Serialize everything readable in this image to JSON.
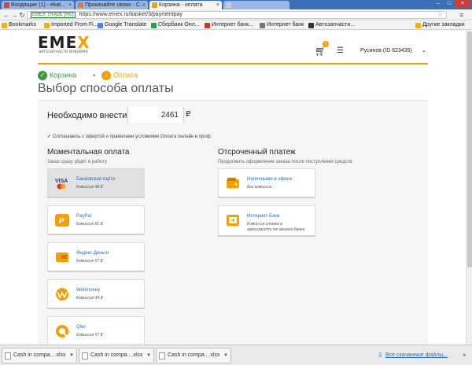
{
  "browser": {
    "tabs": [
      {
        "label": "Входящие (1) - ekat...",
        "active": false,
        "icon_color": "#d44638"
      },
      {
        "label": "Прокачайте своих - С...",
        "active": false,
        "icon_color": "#e07b39"
      },
      {
        "label": "Корзина - оплата",
        "active": true,
        "icon_color": "#f5a000"
      },
      {
        "label": "",
        "active": false,
        "icon_color": "#cccccc"
      }
    ],
    "url_secure": "EMEX TRADE [RU]",
    "url": "https://www.emex.ru/basket/3/paymentpay",
    "bookmarks": [
      {
        "label": "Bookmarks",
        "icon_color": "#f0b400"
      },
      {
        "label": "Imported From Fi...",
        "icon_color": "#f0b400"
      },
      {
        "label": "Google Translate",
        "icon_color": "#4285f4"
      },
      {
        "label": "Сбербанк Онл...",
        "icon_color": "#1ea345"
      },
      {
        "label": "Интернет банк...",
        "icon_color": "#c0392b"
      },
      {
        "label": "Интернет банк",
        "icon_color": "#777777"
      },
      {
        "label": "Автозапчасти...",
        "icon_color": "#333333"
      },
      {
        "label": "Другие закладки",
        "icon_color": "#f0b400"
      }
    ]
  },
  "site": {
    "logo_e1": "E",
    "logo_m": "M",
    "logo_e2": "E",
    "logo_x": "X",
    "logo_sub": "автозапчасти вовремя",
    "cart_count": "1",
    "user": "Русинов (ID 623435)",
    "accent_color": "#f5a000"
  },
  "steps": {
    "cart": "Корзина",
    "payment": "Оплата"
  },
  "page_title": "Выбор способа оплаты",
  "amount": {
    "label": "Необходимо внести",
    "value": "2461",
    "currency": "₽"
  },
  "agreement": "Соглашаюсь с офертой и правилами условиями Оплата онлайн в проф",
  "instant": {
    "title": "Моментальная оплата",
    "subtitle": "Заказ сразу уйдёт в работу",
    "methods": [
      {
        "icon": "visa-mastercard-icon",
        "name": "Банковская карта",
        "fee": "Комиссия 48 ₽",
        "selected": true
      },
      {
        "icon": "paypal-icon",
        "name": "PayPal",
        "fee": "Комиссия 81 ₽",
        "selected": false
      },
      {
        "icon": "yandex-money-icon",
        "name": "Яндекс.Деньги",
        "fee": "Комиссия 57 ₽",
        "selected": false
      },
      {
        "icon": "webmoney-icon",
        "name": "Webmoney",
        "fee": "Комиссия 49 ₽",
        "selected": false
      },
      {
        "icon": "qiwi-icon",
        "name": "Qiwi",
        "fee": "Комиссия 57 ₽",
        "selected": false
      }
    ]
  },
  "deferred": {
    "title": "Отсроченный платеж",
    "subtitle": "Продолжить оформление заказа после поступления средств",
    "methods": [
      {
        "icon": "wallet-icon",
        "name": "Наличными в офисе",
        "fee": "Без комиссии",
        "fee2": ""
      },
      {
        "icon": "bank-icon",
        "name": "Интернет-Банк",
        "fee": "Комиссия ставка в",
        "fee2": "зависимости от вашего банка"
      }
    ]
  },
  "downloads": {
    "items": [
      "Cash in compa....xlsx",
      "Cash in compa....xlsx",
      "Cash in compa....xlsx"
    ],
    "all_label": "Все скачанные файлы..."
  }
}
